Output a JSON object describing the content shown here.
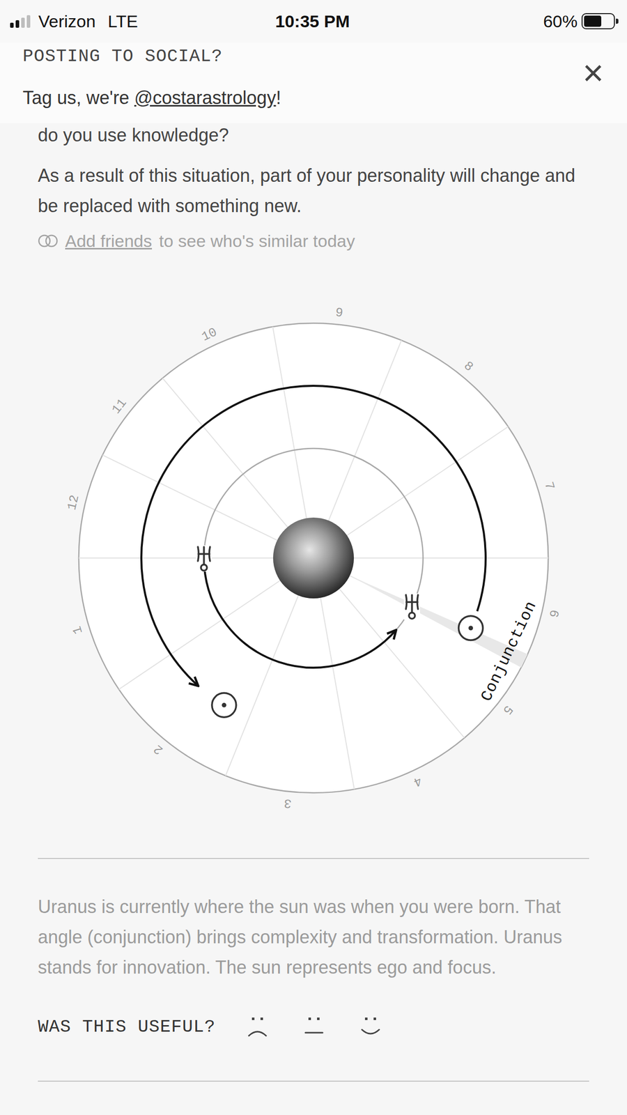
{
  "status_bar": {
    "signal": 0.5,
    "carrier": "Verizon",
    "network": "LTE",
    "time": "10:35 PM",
    "battery": "60%",
    "battery_level": 0.6
  },
  "banner": {
    "title": "POSTING TO SOCIAL?",
    "lead": "Tag us, we're ",
    "handle": "@costarastrology",
    "tail": "!",
    "close": "×"
  },
  "reading": {
    "cut_line": "do you use knowledge?",
    "paragraph": "As a result of this situation, part of your personality will change and be replaced with something new.",
    "friends_link": "Add friends",
    "friends_text": "to see who's similar today"
  },
  "chart": {
    "houses": [
      "1",
      "2",
      "3",
      "4",
      "5",
      "6",
      "7",
      "8",
      "9",
      "10",
      "11",
      "12"
    ],
    "aspect": "Conjunction"
  },
  "explanation": "Uranus is currently where the sun was when you were born. That angle (conjunction) brings complexity and transformation. Uranus stands for innovation. The sun represents ego and focus.",
  "feedback": {
    "question": "WAS THIS USEFUL?",
    "options": [
      {
        "kind": "sad",
        "selected": false
      },
      {
        "kind": "neutral",
        "selected": false
      },
      {
        "kind": "happy",
        "selected": false
      }
    ]
  }
}
